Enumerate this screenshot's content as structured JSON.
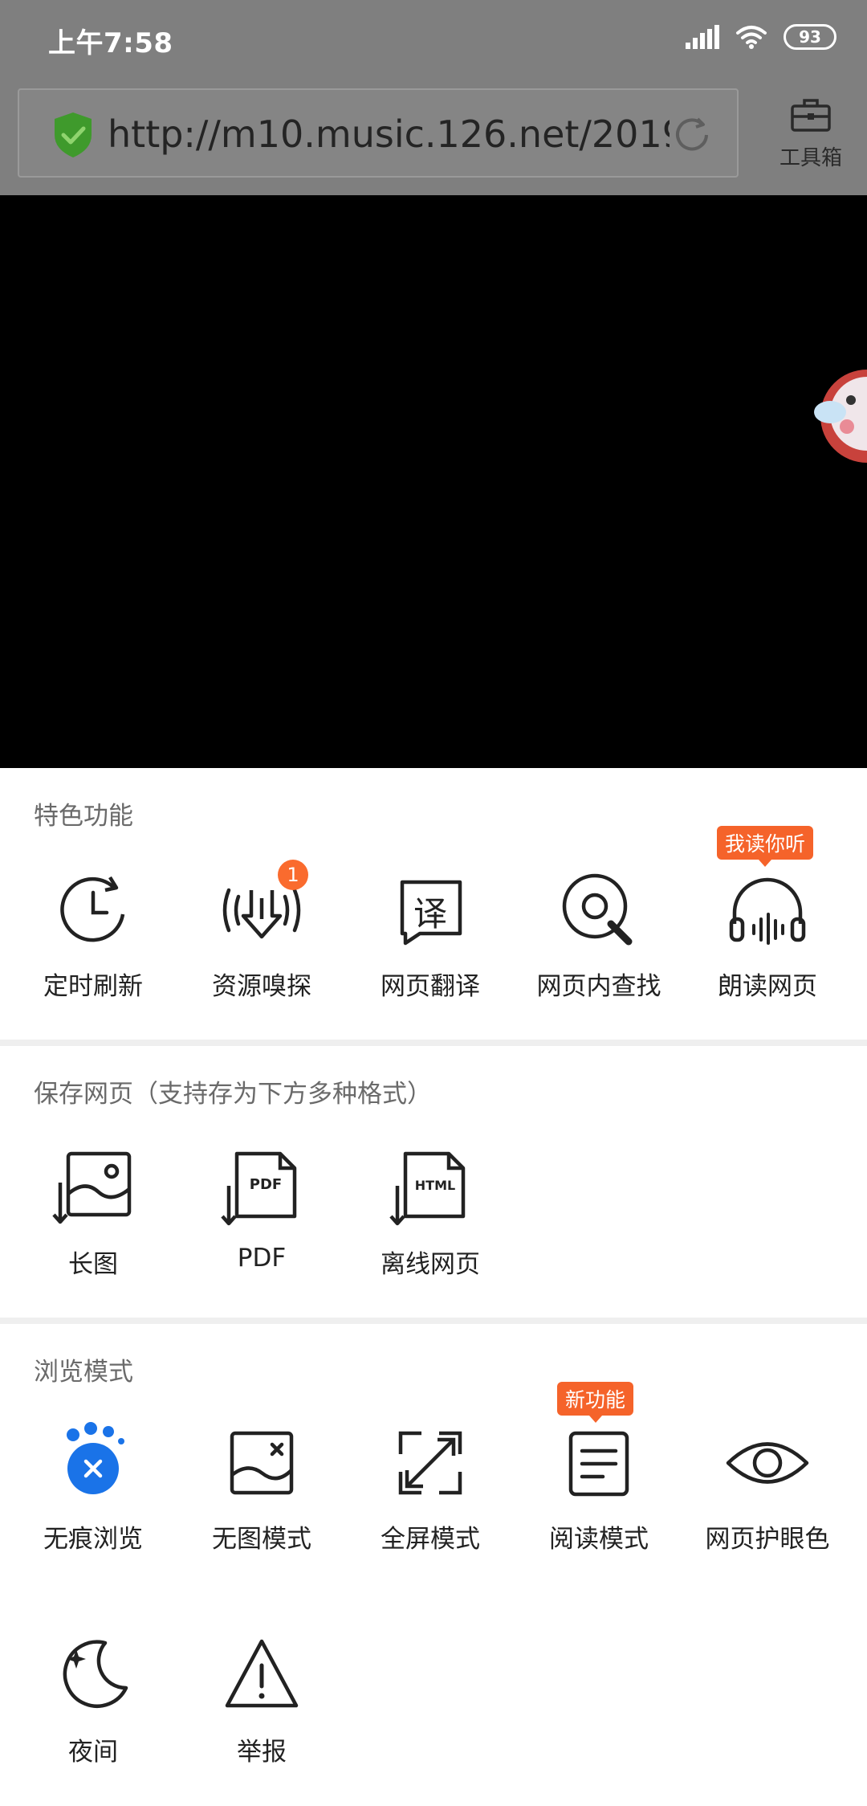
{
  "status": {
    "time": "上午7:58",
    "battery": "93"
  },
  "browser": {
    "url": "http://m10.music.126.net/20190...",
    "toolbox_label": "工具箱"
  },
  "sections": {
    "featured": {
      "title": "特色功能",
      "items": [
        {
          "label": "定时刷新",
          "icon": "timer-refresh-icon"
        },
        {
          "label": "资源嗅探",
          "icon": "resource-sniff-icon",
          "badge": "1"
        },
        {
          "label": "网页翻译",
          "icon": "translate-icon"
        },
        {
          "label": "网页内查找",
          "icon": "find-in-page-icon"
        },
        {
          "label": "朗读网页",
          "icon": "headphones-icon",
          "tag": "我读你听"
        }
      ]
    },
    "save": {
      "title": "保存网页（支持存为下方多种格式）",
      "items": [
        {
          "label": "长图",
          "icon": "long-image-icon"
        },
        {
          "label": "PDF",
          "icon": "pdf-icon"
        },
        {
          "label": "离线网页",
          "icon": "html-icon"
        }
      ]
    },
    "browse": {
      "title": "浏览模式",
      "items": [
        {
          "label": "无痕浏览",
          "icon": "incognito-icon"
        },
        {
          "label": "无图模式",
          "icon": "no-image-icon"
        },
        {
          "label": "全屏模式",
          "icon": "fullscreen-icon"
        },
        {
          "label": "阅读模式",
          "icon": "reading-mode-icon",
          "tag": "新功能"
        },
        {
          "label": "网页护眼色",
          "icon": "eye-icon"
        },
        {
          "label": "夜间",
          "icon": "night-moon-icon"
        },
        {
          "label": "举报",
          "icon": "report-warning-icon"
        }
      ]
    }
  },
  "icon_text": {
    "translate": "译",
    "pdf": "PDF",
    "html": "HTML"
  },
  "colors": {
    "accent": "#1a73e8",
    "tag": "#f5632a",
    "shield": "#3f9a2c"
  }
}
